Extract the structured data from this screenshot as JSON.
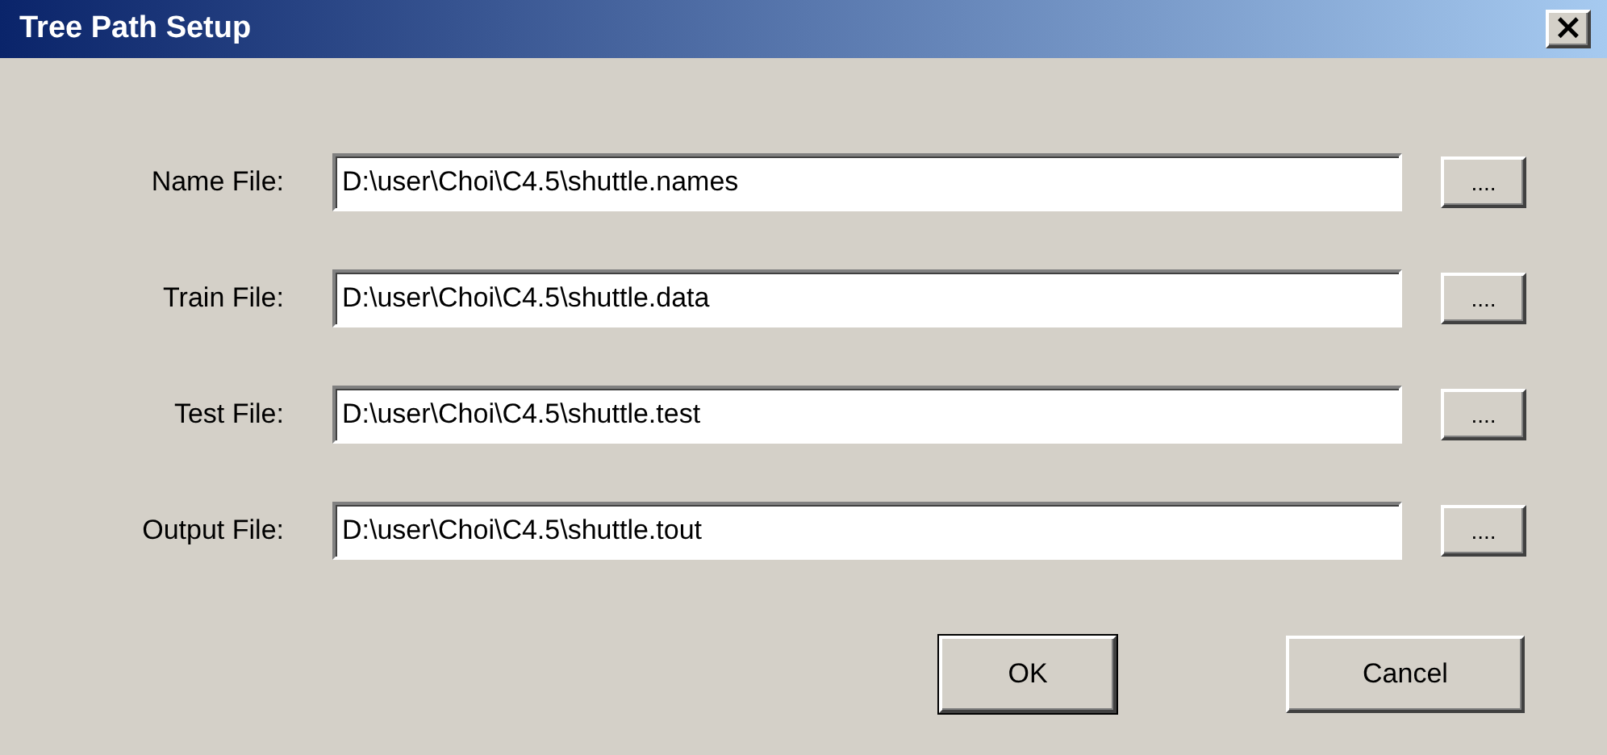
{
  "window": {
    "title": "Tree Path Setup",
    "close": "×"
  },
  "fields": [
    {
      "label": "Name File:",
      "value": "D:\\user\\Choi\\C4.5\\shuttle.names",
      "browse": "...."
    },
    {
      "label": "Train File:",
      "value": "D:\\user\\Choi\\C4.5\\shuttle.data",
      "browse": "...."
    },
    {
      "label": "Test File:",
      "value": "D:\\user\\Choi\\C4.5\\shuttle.test",
      "browse": "...."
    },
    {
      "label": "Output File:",
      "value": "D:\\user\\Choi\\C4.5\\shuttle.tout",
      "browse": "...."
    }
  ],
  "buttons": [
    {
      "label": "OK",
      "default": true
    },
    {
      "label": "Cancel",
      "default": false
    }
  ]
}
